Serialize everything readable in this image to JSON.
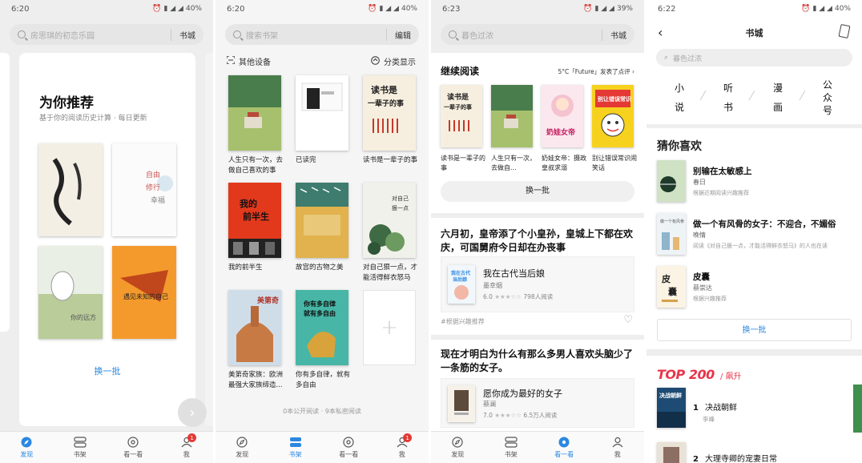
{
  "screens": [
    {
      "time": "6:20",
      "battery": "40%",
      "search_placeholder": "房思琪的初恋乐园",
      "search_action": "书城",
      "title": "为你推荐",
      "subtitle": "基于你的阅读历史计算 · 每日更新",
      "refresh_label": "换一批"
    },
    {
      "time": "6:20",
      "battery": "40%",
      "search_placeholder": "搜索书架",
      "search_action": "编辑",
      "devices_label": "其他设备",
      "sort_label": "分类显示",
      "books": [
        {
          "title": "人生只有一次，去做自己喜欢的事"
        },
        {
          "title": "已读完"
        },
        {
          "title": "读书是一辈子的事"
        },
        {
          "title": "我的前半生"
        },
        {
          "title": "故宫的古物之美"
        },
        {
          "title": "对自己狠一点，才能活得鲜衣怒马"
        },
        {
          "title": "美第奇家族：欧洲最强大家族缔造..."
        },
        {
          "title": "你有多自律，就有多自由"
        }
      ],
      "add_symbol": "+",
      "footer": "0本公开阅读 · 9本私密阅读"
    },
    {
      "time": "6:23",
      "battery": "39%",
      "search_placeholder": "暮色过浓",
      "search_action": "书城",
      "continue_heading": "继续阅读",
      "weather_note": "5°C「Future」发表了点评 ›",
      "continue_books": [
        {
          "title": "读书是一辈子的事"
        },
        {
          "title": "人生只有一次，去做自..."
        },
        {
          "title": "奶娃女帝：摄政皇叔求溺"
        },
        {
          "title": "别让错误常识闹笑话"
        }
      ],
      "refresh_label": "换一批",
      "story1": {
        "question": "六月初，皇帝添了个小皇孙，皇城上下都在欢庆，可国舅府今日却在办丧事",
        "book_title": "我在古代当后娘",
        "author": "墨幸烟",
        "rating": "6.0",
        "readers": "798人阅读",
        "tag": "#根据兴趣推荐"
      },
      "story2": {
        "question": "现在才明白为什么有那么多男人喜欢头脑少了一条筋的女子。",
        "book_title": "愿你成为最好的女子",
        "author": "蔡澜",
        "rating": "7.0",
        "readers": "6.5万人阅读"
      }
    },
    {
      "time": "6:22",
      "battery": "40%",
      "page_title": "书城",
      "search_placeholder": "暮色过浓",
      "categories": [
        "小说",
        "听书",
        "漫画",
        "公众号"
      ],
      "guess_heading": "猜你喜欢",
      "guess_items": [
        {
          "title": "别输在太敏感上",
          "author": "春日",
          "reason": "根据近期阅读兴趣推荐"
        },
        {
          "title": "做一个有风骨的女子：不迎合，不媚俗",
          "author": "晚情",
          "reason": "阅读《对自己狠一点，才能活得鲜衣怒马》的人也在读"
        },
        {
          "title": "皮囊",
          "author": "蔡崇达",
          "reason": "根据兴趣推荐"
        }
      ],
      "refresh_label": "换一批",
      "top_logo": "TOP 200",
      "rising_label": "飙升",
      "ranking": [
        {
          "rank": "1",
          "title": "决战朝鲜",
          "author": "李峰"
        },
        {
          "rank": "2",
          "title": "大理寺卿的宠妻日常"
        }
      ]
    }
  ],
  "tabs_discover": [
    "发现",
    "书架",
    "看一看",
    "我"
  ],
  "badge_count": "1",
  "colors": {
    "accent": "#2b88e0",
    "top200": "#e8354a",
    "badge": "#e53935"
  }
}
